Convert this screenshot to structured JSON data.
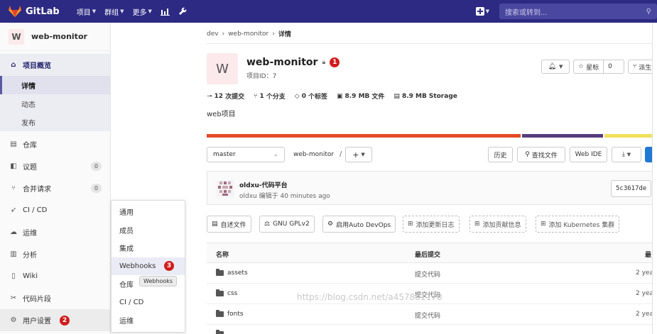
{
  "navbar": {
    "brand": "GitLab",
    "menus": [
      "项目",
      "群组",
      "更多"
    ],
    "search_placeholder": "搜索或转到..."
  },
  "sidebar": {
    "project_initial": "W",
    "project_name": "web-monitor",
    "overview": {
      "label": "项目概览",
      "children": [
        "详情",
        "动态",
        "发布"
      ]
    },
    "items": [
      {
        "label": "仓库",
        "icon": "book-icon"
      },
      {
        "label": "议题",
        "icon": "issues-icon",
        "count": "0"
      },
      {
        "label": "合并请求",
        "icon": "merge-request-icon",
        "count": "0"
      },
      {
        "label": "CI / CD",
        "icon": "rocket-icon"
      },
      {
        "label": "运维",
        "icon": "cloud-icon"
      },
      {
        "label": "分析",
        "icon": "chart-icon"
      },
      {
        "label": "Wiki",
        "icon": "book-icon"
      },
      {
        "label": "代码片段",
        "icon": "scissors-icon"
      }
    ],
    "settings": {
      "label": "用户设置",
      "badge": "2"
    }
  },
  "flyout": {
    "items": [
      "通用",
      "成员",
      "集成",
      "Webhooks",
      "仓库",
      "CI / CD",
      "运维"
    ],
    "badge": "3",
    "tooltip": "Webhooks"
  },
  "breadcrumb": [
    "dev",
    "web-monitor",
    "详情"
  ],
  "project": {
    "initial": "W",
    "title": "web-monitor",
    "title_badge": "1",
    "id_label": "项目ID：7",
    "star_label": "星标",
    "star_count": "0",
    "fork_label": "派生",
    "description": "web项目"
  },
  "stats": [
    {
      "value": "12",
      "label": "次提交",
      "icon": "commit-icon"
    },
    {
      "value": "1",
      "label": "个分支",
      "icon": "branch-icon"
    },
    {
      "value": "0",
      "label": "个标签",
      "icon": "tag-icon"
    },
    {
      "value": "8.9 MB",
      "label": "文件",
      "icon": "file-icon"
    },
    {
      "value": "8.9 MB",
      "label": "Storage",
      "icon": "storage-icon"
    }
  ],
  "language_colors": [
    "#e34c26",
    "#563d7c",
    "#f1e05a"
  ],
  "repo": {
    "branch": "master",
    "path": "web-monitor",
    "history_label": "历史",
    "find_file_label": "查找文件",
    "web_ide_label": "Web IDE"
  },
  "commit": {
    "title": "oldxu-代码平台",
    "meta": "oldxu 编辑于 40 minutes ago",
    "sha": "5c3617de"
  },
  "quick_actions": {
    "readme": "自述文件",
    "license": "GNU GPLv2",
    "devops": "启用Auto DevOps",
    "changelog": "添加更新日志",
    "contributing": "添加贡献信息",
    "kubernetes": "添加 Kubernetes 集群"
  },
  "table": {
    "headers": [
      "名称",
      "最后提交",
      "最"
    ],
    "rows": [
      {
        "name": "assets",
        "message": "提交代码",
        "age": "2 yea"
      },
      {
        "name": "css",
        "message": "提交代码",
        "age": "2 yea"
      },
      {
        "name": "fonts",
        "message": "提交代码",
        "age": "2 yea"
      }
    ]
  },
  "watermark": "https://blog.csdn.net/a457801170"
}
